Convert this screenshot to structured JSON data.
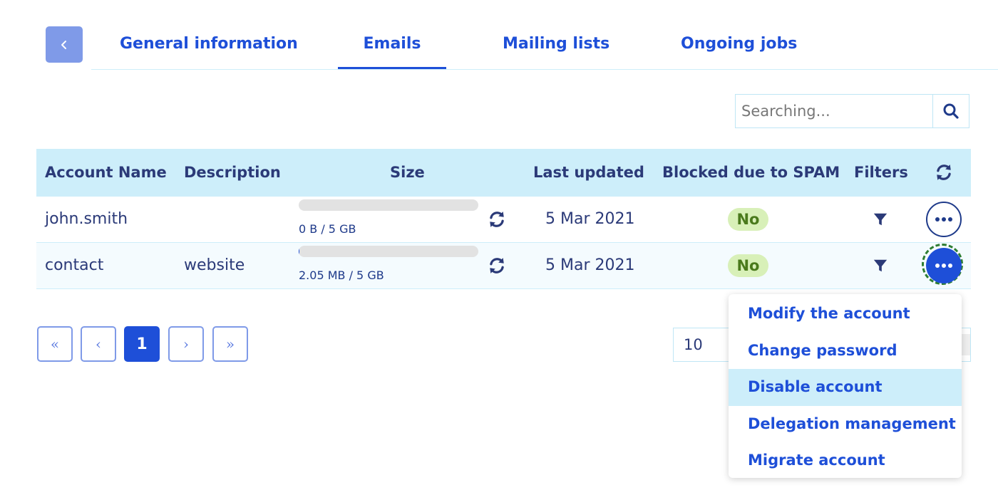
{
  "tabs": {
    "back_icon": "chevron-left-icon",
    "items": [
      {
        "label": "General information",
        "active": false
      },
      {
        "label": "Emails",
        "active": true
      },
      {
        "label": "Mailing lists",
        "active": false
      },
      {
        "label": "Ongoing jobs",
        "active": false
      }
    ]
  },
  "search": {
    "value": "",
    "placeholder": "Searching...",
    "icon": "search-icon"
  },
  "table": {
    "columns": [
      "Account Name",
      "Description",
      "Size",
      "Last updated",
      "Blocked due to SPAM",
      "Filters"
    ],
    "refresh_icon": "refresh-icon",
    "rows": [
      {
        "account": "john.smith",
        "description": "",
        "size_text": "0 B / 5 GB",
        "size_fraction": 0,
        "last_updated": "5 Mar 2021",
        "blocked": "No"
      },
      {
        "account": "contact",
        "description": "website",
        "size_text": "2.05 MB / 5 GB",
        "size_fraction": 0.0004,
        "last_updated": "5 Mar 2021",
        "blocked": "No"
      }
    ]
  },
  "pagination": {
    "first": "«",
    "prev": "‹",
    "current": "1",
    "next": "›",
    "last": "»",
    "per_page": "10"
  },
  "dropdown": {
    "items": [
      "Modify the account",
      "Change password",
      "Disable account",
      "Delegation management",
      "Migrate account"
    ],
    "highlighted": "Disable account"
  },
  "colors": {
    "accent": "#1e4fd8",
    "header_bg": "#cdeefa",
    "badge_bg": "#d8f0b8",
    "badge_text": "#4a7a1c",
    "focus_ring": "#2e7d32"
  }
}
